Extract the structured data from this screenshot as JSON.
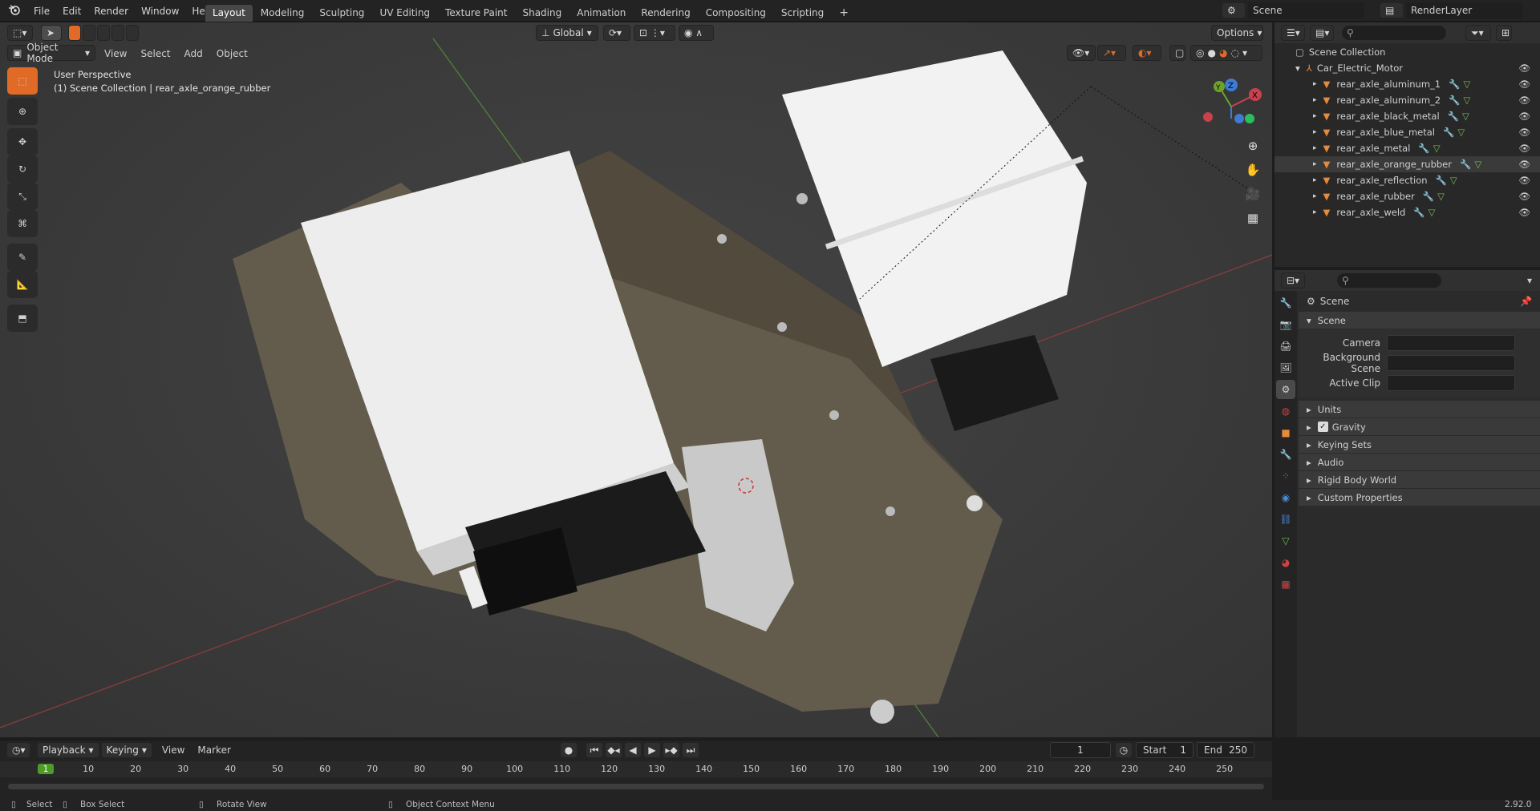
{
  "menu": {
    "items": [
      "File",
      "Edit",
      "Render",
      "Window",
      "Help"
    ]
  },
  "workspaces": [
    "Layout",
    "Modeling",
    "Sculpting",
    "UV Editing",
    "Texture Paint",
    "Shading",
    "Animation",
    "Rendering",
    "Compositing",
    "Scripting"
  ],
  "scene_name": "Scene",
  "render_layer": "RenderLayer",
  "viewport": {
    "mode": "Object Mode",
    "menus": [
      "View",
      "Select",
      "Add",
      "Object"
    ],
    "transform": "Global",
    "options": "Options",
    "overlay_line1": "User Perspective",
    "overlay_line2": "(1) Scene Collection | rear_axle_orange_rubber",
    "gizmo": {
      "x": "X",
      "y": "Y",
      "z": "Z"
    }
  },
  "outliner": {
    "root": "Scene Collection",
    "collection": "Car_Electric_Motor",
    "items": [
      "rear_axle_aluminum_1",
      "rear_axle_aluminum_2",
      "rear_axle_black_metal",
      "rear_axle_blue_metal",
      "rear_axle_metal",
      "rear_axle_orange_rubber",
      "rear_axle_reflection",
      "rear_axle_rubber",
      "rear_axle_weld"
    ],
    "selected_index": 5
  },
  "properties": {
    "context": "Scene",
    "section": "Scene",
    "fields": [
      {
        "label": "Camera"
      },
      {
        "label": "Background Scene"
      },
      {
        "label": "Active Clip"
      }
    ],
    "subsections": [
      "Units",
      "Gravity",
      "Keying Sets",
      "Audio",
      "Rigid Body World",
      "Custom Properties"
    ],
    "gravity_checked": true
  },
  "timeline": {
    "menus": [
      "Playback",
      "Keying",
      "View",
      "Marker"
    ],
    "current_frame": "1",
    "start_label": "Start",
    "start": "1",
    "end_label": "End",
    "end": "250",
    "ticks": [
      "1",
      "10",
      "20",
      "30",
      "40",
      "50",
      "60",
      "70",
      "80",
      "90",
      "100",
      "110",
      "120",
      "130",
      "140",
      "150",
      "160",
      "170",
      "180",
      "190",
      "200",
      "210",
      "220",
      "230",
      "240",
      "250"
    ]
  },
  "status": {
    "select": "Select",
    "box_select": "Box Select",
    "rotate_view": "Rotate View",
    "context_menu": "Object Context Menu",
    "version": "2.92.0"
  },
  "colors": {
    "accent": "#e06a26",
    "selected_blue": "#4772b3",
    "x_axis": "#c8414b",
    "y_axis": "#6ea32b",
    "z_axis": "#3f7bd1"
  }
}
